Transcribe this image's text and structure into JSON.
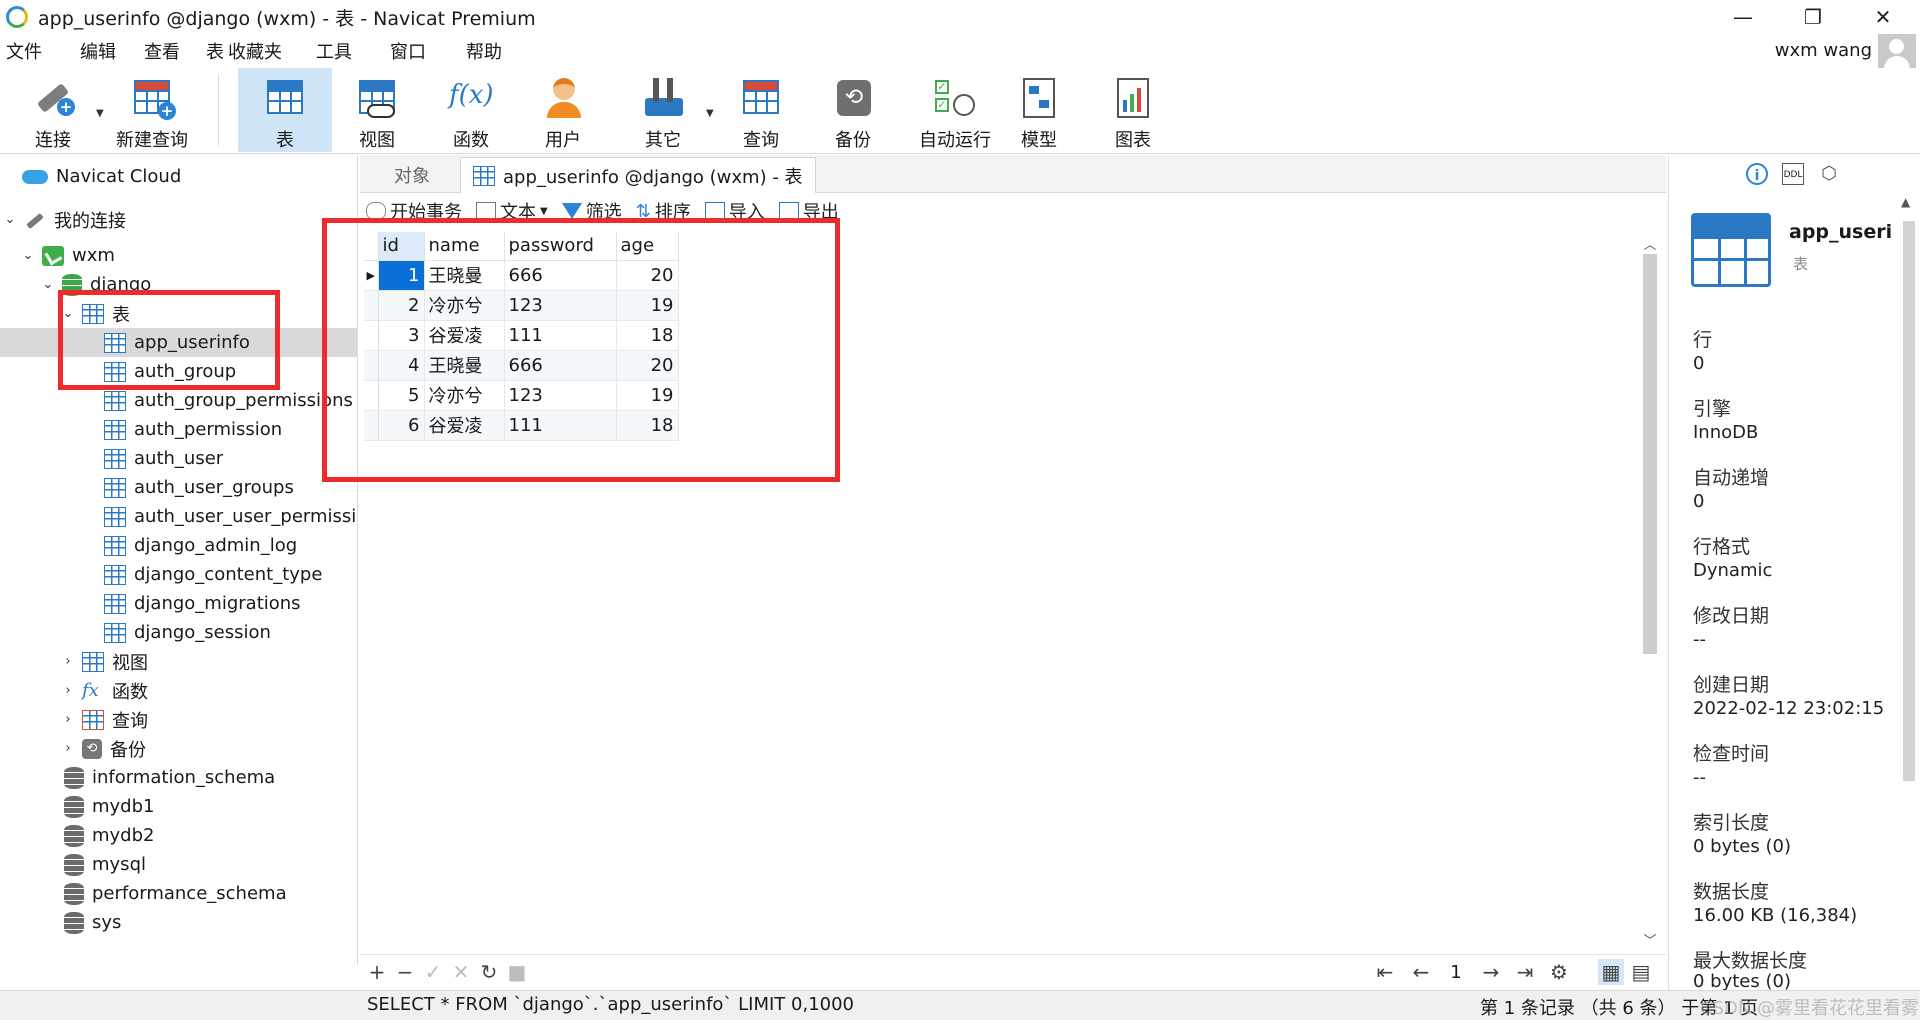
{
  "window": {
    "title": "app_userinfo @django (wxm) - 表 - Navicat Premium",
    "minimize_glyph": "—",
    "restore_glyph": "❐",
    "close_glyph": "✕"
  },
  "menu": {
    "items": [
      "文件",
      "编辑",
      "查看",
      "表",
      "收藏夹",
      "工具",
      "窗口",
      "帮助"
    ],
    "user_name": "wxm wang"
  },
  "toolbar": {
    "buttons": [
      {
        "label": "连接",
        "icon": "plug-icon"
      },
      {
        "label": "新建查询",
        "icon": "new-query-icon"
      },
      {
        "label": "表",
        "icon": "table-icon"
      },
      {
        "label": "视图",
        "icon": "view-icon"
      },
      {
        "label": "函数",
        "icon": "function-icon"
      },
      {
        "label": "用户",
        "icon": "user-icon"
      },
      {
        "label": "其它",
        "icon": "tools-icon"
      },
      {
        "label": "查询",
        "icon": "query-icon"
      },
      {
        "label": "备份",
        "icon": "backup-icon"
      },
      {
        "label": "自动运行",
        "icon": "auto-run-icon"
      },
      {
        "label": "模型",
        "icon": "model-icon"
      },
      {
        "label": "图表",
        "icon": "chart-icon"
      }
    ],
    "fx_glyph": "f(x)"
  },
  "tree": {
    "cloud": "Navicat Cloud",
    "my_connections": "我的连接",
    "connection": "wxm",
    "database": "django",
    "tables_group": "表",
    "tables": [
      "app_userinfo",
      "auth_group",
      "auth_group_permissions",
      "auth_permission",
      "auth_user",
      "auth_user_groups",
      "auth_user_user_permissions",
      "django_admin_log",
      "django_content_type",
      "django_migrations",
      "django_session"
    ],
    "views_group": "视图",
    "functions_group": "函数",
    "queries_group": "查询",
    "backups_group": "备份",
    "other_databases": [
      "information_schema",
      "mydb1",
      "mydb2",
      "mysql",
      "performance_schema",
      "sys"
    ]
  },
  "tabs": {
    "objects": "对象",
    "table_tab": "app_userinfo @django (wxm) - 表"
  },
  "subtoolbar": {
    "begin_transaction": "开始事务",
    "text": "文本",
    "filter": "筛选",
    "sort": "排序",
    "import": "导入",
    "export": "导出"
  },
  "grid": {
    "columns": [
      "id",
      "name",
      "password",
      "age"
    ],
    "rows": [
      [
        "1",
        "王晓曼",
        "666",
        "20"
      ],
      [
        "2",
        "冷亦兮",
        "123",
        "19"
      ],
      [
        "3",
        "谷爱凌",
        "111",
        "18"
      ],
      [
        "4",
        "王晓曼",
        "666",
        "20"
      ],
      [
        "5",
        "冷亦兮",
        "123",
        "19"
      ],
      [
        "6",
        "谷爱凌",
        "111",
        "18"
      ]
    ]
  },
  "footer": {
    "page": "1"
  },
  "status": {
    "sql": "SELECT * FROM `django`.`app_userinfo` LIMIT 0,1000",
    "records": "第 1 条记录 （共 6 条） 于第 1 页",
    "watermark": "CSDN @雾里看花花里看雾"
  },
  "info_panel": {
    "table_name": "app_useri",
    "table_type": "表",
    "properties": [
      {
        "label": "行",
        "value": "0"
      },
      {
        "label": "引擎",
        "value": "InnoDB"
      },
      {
        "label": "自动递增",
        "value": "0"
      },
      {
        "label": "行格式",
        "value": "Dynamic"
      },
      {
        "label": "修改日期",
        "value": "--"
      },
      {
        "label": "创建日期",
        "value": "2022-02-12 23:02:15"
      },
      {
        "label": "检查时间",
        "value": "--"
      },
      {
        "label": "索引长度",
        "value": "0 bytes (0)"
      },
      {
        "label": "数据长度",
        "value": "16.00 KB (16,384)"
      },
      {
        "label": "最大数据长度",
        "value": "0 bytes (0)"
      }
    ]
  },
  "colors": {
    "accent": "#2b78c4",
    "selection": "#0a6fd6",
    "highlight_box": "#ee2b2b"
  }
}
